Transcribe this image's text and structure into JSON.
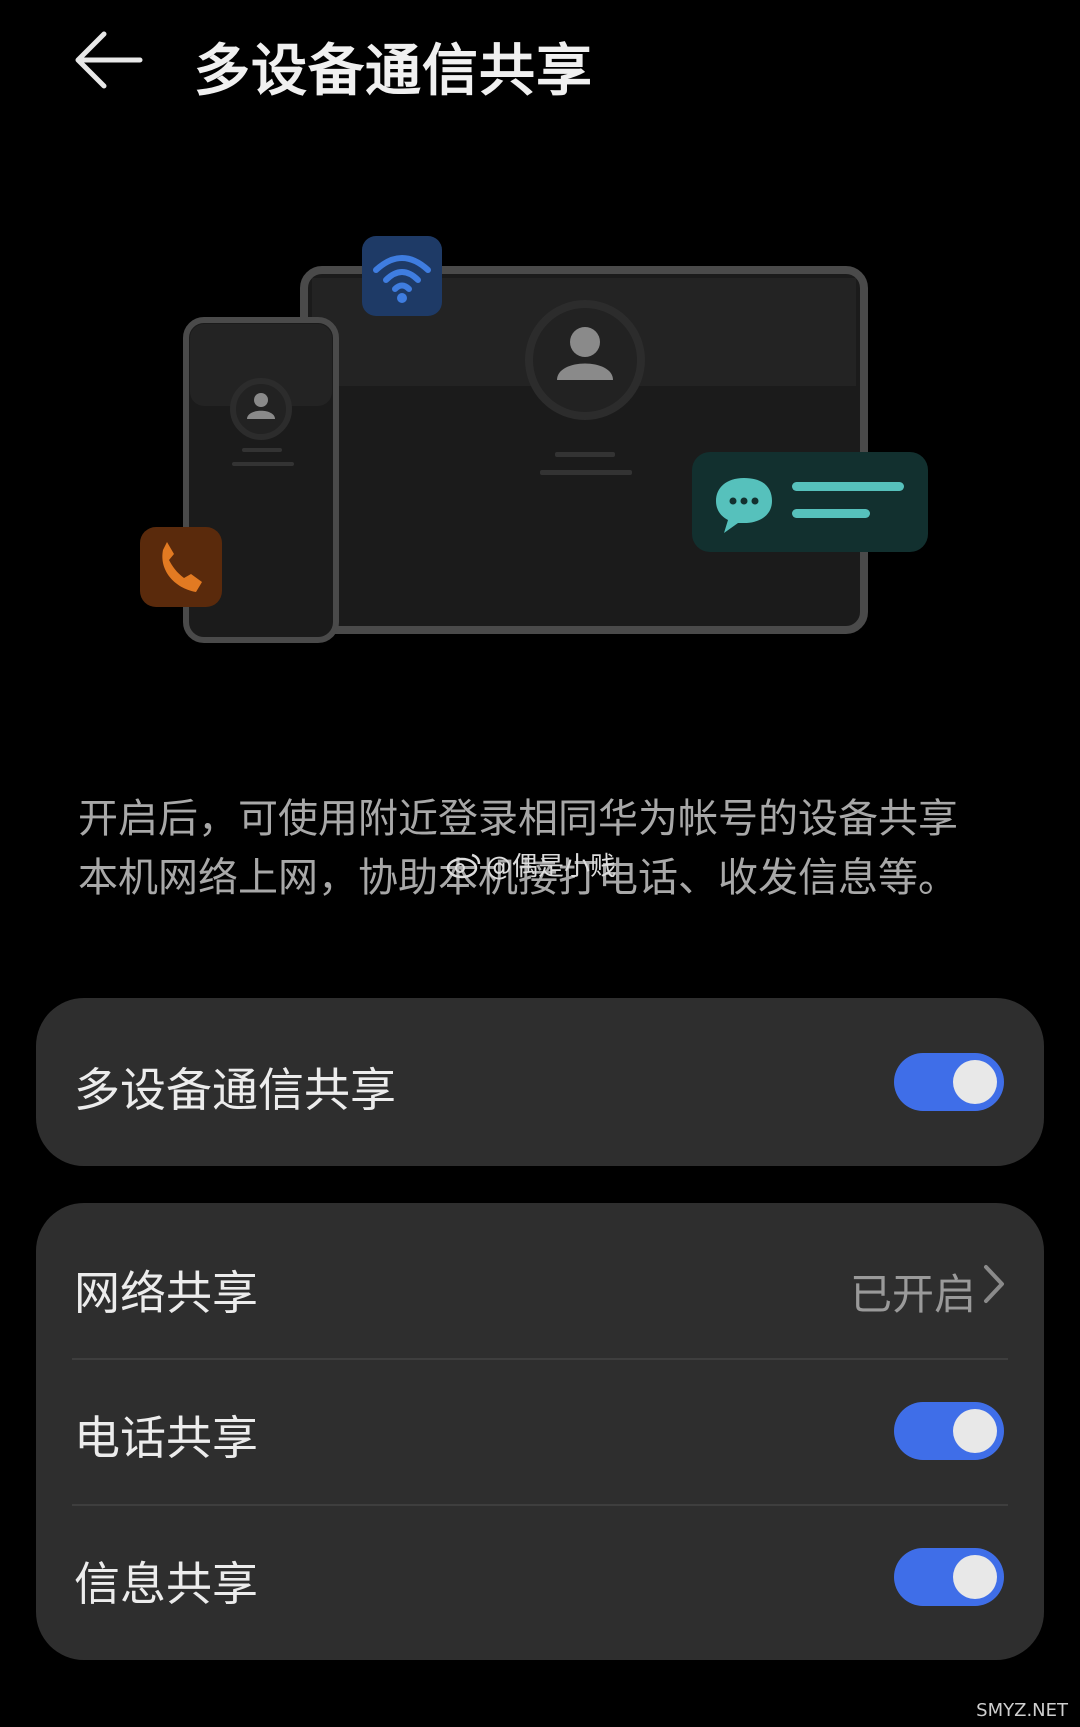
{
  "header": {
    "title": "多设备通信共享"
  },
  "description": {
    "line1": "开启后，可使用附近登录相同华为帐号的设备共享",
    "line2": "本机网络上网，协助本机接打电话、收发信息等。"
  },
  "watermark": {
    "handle": "@偶是小贱"
  },
  "main_toggle": {
    "label": "多设备通信共享",
    "enabled": true
  },
  "group": {
    "network": {
      "label": "网络共享",
      "status": "已开启"
    },
    "phone": {
      "label": "电话共享",
      "enabled": true
    },
    "message": {
      "label": "信息共享",
      "enabled": true
    }
  },
  "footer": {
    "site": "SMYZ.NET"
  },
  "colors": {
    "accent": "#3f6ee8",
    "card_bg": "#2e2e2e",
    "wifi_badge": "#1e3a66",
    "phone_badge": "#5a2a0c",
    "chat_badge": "#12302f"
  },
  "icons": [
    "back-arrow-icon",
    "wifi-icon",
    "phone-icon",
    "chat-icon",
    "person-icon",
    "chevron-right-icon",
    "weibo-icon"
  ]
}
